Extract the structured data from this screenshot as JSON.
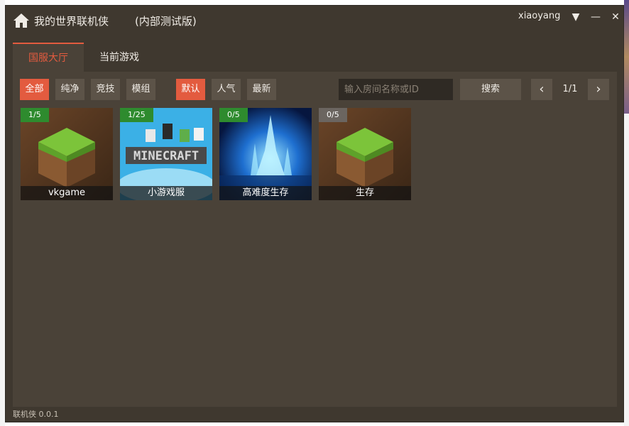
{
  "window": {
    "title": "我的世界联机侠",
    "edition": "(内部测试版)",
    "username": "xiaoyang",
    "controls": {
      "menu_glyph": "▼",
      "min_glyph": "—",
      "close_glyph": "✕"
    }
  },
  "tabs": [
    {
      "label": "国服大厅",
      "active": true
    },
    {
      "label": "当前游戏",
      "active": false
    }
  ],
  "filters": {
    "category": [
      {
        "label": "全部",
        "active": true
      },
      {
        "label": "纯净",
        "active": false
      },
      {
        "label": "竞技",
        "active": false
      },
      {
        "label": "模组",
        "active": false
      }
    ],
    "sort": [
      {
        "label": "默认",
        "active": true
      },
      {
        "label": "人气",
        "active": false
      },
      {
        "label": "最新",
        "active": false
      }
    ]
  },
  "search": {
    "placeholder": "输入房间名称或ID",
    "value": "",
    "button_label": "搜索"
  },
  "pagination": {
    "prev_glyph": "‹",
    "next_glyph": "›",
    "indicator": "1/1"
  },
  "rooms": [
    {
      "name": "vkgame",
      "count": "1/5",
      "thumb": "grass-block",
      "badge_color": "#2e8b2e"
    },
    {
      "name": "小游戏服",
      "count": "1/25",
      "thumb": "minecraft-logo",
      "badge_color": "#2e8b2e"
    },
    {
      "name": "高难度生存",
      "count": "0/5",
      "thumb": "ice-castle",
      "badge_color": "#2e8b2e"
    },
    {
      "name": "生存",
      "count": "0/5",
      "thumb": "grass-block",
      "badge_color": "#6b6560"
    }
  ],
  "footer": {
    "version": "联机侠 0.0.1"
  },
  "colors": {
    "accent": "#e35b3f",
    "window_bg": "#3f382f",
    "panel_bg": "#4a4238"
  }
}
